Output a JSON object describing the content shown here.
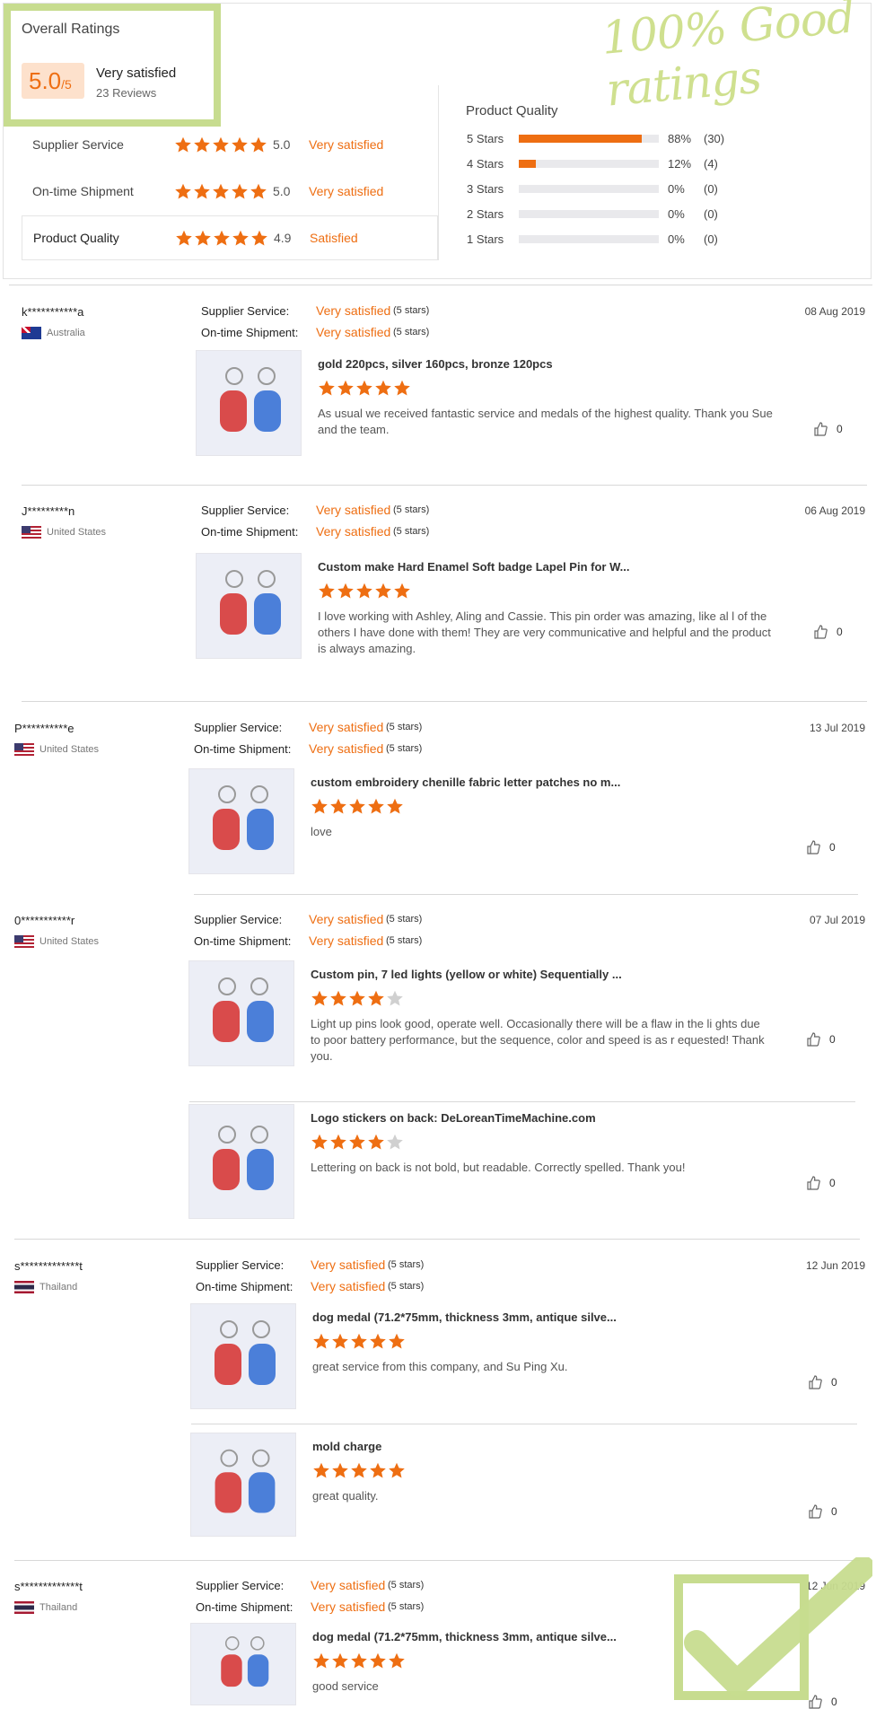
{
  "overall": {
    "title": "Overall Ratings",
    "score": "5.0",
    "score_max": "/5",
    "label": "Very satisfied",
    "reviews": "23 Reviews"
  },
  "watermark": "100% Good ratings",
  "dimensions": [
    {
      "name": "Supplier Service",
      "stars": 5,
      "score": "5.0",
      "label": "Very satisfied"
    },
    {
      "name": "On-time Shipment",
      "stars": 5,
      "score": "5.0",
      "label": "Very satisfied"
    },
    {
      "name": "Product Quality",
      "stars": 5,
      "score": "4.9",
      "label": "Satisfied"
    }
  ],
  "product_quality": {
    "title": "Product Quality",
    "rows": [
      {
        "label": "5 Stars",
        "fraction": 0.88,
        "pct": "88%",
        "count": "(30)"
      },
      {
        "label": "4 Stars",
        "fraction": 0.12,
        "pct": "12%",
        "count": "(4)"
      },
      {
        "label": "3 Stars",
        "fraction": 0,
        "pct": "0%",
        "count": "(0)"
      },
      {
        "label": "2 Stars",
        "fraction": 0,
        "pct": "0%",
        "count": "(0)"
      },
      {
        "label": "1 Stars",
        "fraction": 0,
        "pct": "0%",
        "count": "(0)"
      }
    ]
  },
  "meta_labels": {
    "supplier": "Supplier Service:",
    "shipment": "On-time Shipment:",
    "value": "Very satisfied",
    "stars": "(5 stars)"
  },
  "reviews": [
    {
      "user": "k***********a",
      "country": "Australia",
      "date": "08 Aug 2019",
      "items": [
        {
          "title": "gold 220pcs, silver 160pcs, bronze 120pcs",
          "stars": 5,
          "comment": "As usual we received fantastic service and medals of the highest quality. Thank you Sue and the team.",
          "likes": "0"
        }
      ]
    },
    {
      "user": "J*********n",
      "country": "United States",
      "date": "06 Aug 2019",
      "items": [
        {
          "title": "Custom make Hard Enamel Soft badge Lapel Pin for W...",
          "stars": 5,
          "comment": "I love working with Ashley, Aling and Cassie. This pin order was amazing, like al l of the others I have done with them! They are very communicative and helpful and the product is always amazing.",
          "likes": "0"
        }
      ]
    },
    {
      "user": "P**********e",
      "country": "United States",
      "date": "13 Jul 2019",
      "items": [
        {
          "title": "custom embroidery chenille fabric letter patches no m...",
          "stars": 5,
          "comment": "love",
          "likes": "0"
        }
      ]
    },
    {
      "user": "0***********r",
      "country": "United States",
      "date": "07 Jul 2019",
      "items": [
        {
          "title": "Custom pin, 7 led lights (yellow or white) Sequentially ...",
          "stars": 4,
          "comment": "Light up pins look good, operate well.  Occasionally there will be a flaw in the li ghts due to poor battery performance, but the sequence, color and speed is as r equested!  Thank you.",
          "likes": "0"
        },
        {
          "title": "Logo stickers on back: DeLoreanTimeMachine.com",
          "stars": 4,
          "comment": "Lettering on back is not bold, but readable.  Correctly spelled.  Thank you!",
          "likes": "0"
        }
      ]
    },
    {
      "user": "s*************t",
      "country": "Thailand",
      "date": "12 Jun 2019",
      "items": [
        {
          "title": "dog medal (71.2*75mm, thickness 3mm, antique silve...",
          "stars": 5,
          "comment": "great service from this company, and Su Ping Xu.",
          "likes": "0"
        },
        {
          "title": "mold charge",
          "stars": 5,
          "comment": "great quality.",
          "likes": "0"
        }
      ]
    },
    {
      "user": "s*************t",
      "country": "Thailand",
      "date": "12 Jun 2019",
      "items": [
        {
          "title": "dog medal (71.2*75mm, thickness 3mm, antique silve...",
          "stars": 5,
          "comment": "good service",
          "likes": "0"
        }
      ]
    }
  ],
  "colors": {
    "accent": "#ee6e12",
    "green": "#c7dc8f",
    "track": "#e9e9ec"
  }
}
